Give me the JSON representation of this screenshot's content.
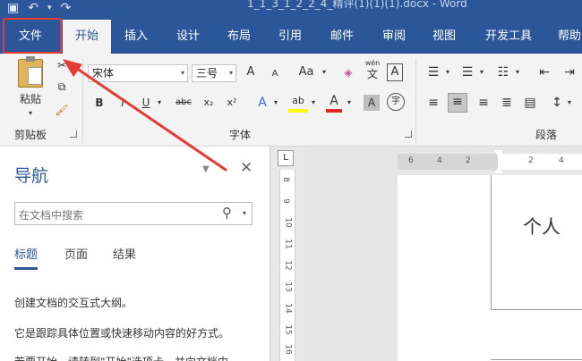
{
  "app": {
    "doc_title": "1_1_3_1_2_2_4_精评(1)(1)(1).docx  -  Word"
  },
  "quick_access": [
    {
      "icon": "save-icon",
      "glyph": "💾"
    },
    {
      "icon": "undo-icon",
      "glyph": "↶"
    },
    {
      "icon": "undo-dropdown-icon",
      "glyph": "▾"
    },
    {
      "icon": "redo-icon",
      "glyph": "↷"
    }
  ],
  "tabs": [
    {
      "label": "文件"
    },
    {
      "label": "开始"
    },
    {
      "label": "插入"
    },
    {
      "label": "设计"
    },
    {
      "label": "布局"
    },
    {
      "label": "引用"
    },
    {
      "label": "邮件"
    },
    {
      "label": "审阅"
    },
    {
      "label": "视图"
    },
    {
      "label": "开发工具"
    },
    {
      "label": "帮助"
    }
  ],
  "ribbon": {
    "clipboard": {
      "group_label": "剪贴板",
      "paste_label": "粘贴"
    },
    "font": {
      "group_label": "字体",
      "font_name": "宋体",
      "font_size": "三号",
      "grow_label": "A",
      "shrink_label": "A",
      "case_label": "Aa",
      "phonetic_label": "wén",
      "phonetic_char": "文",
      "border_char": "A",
      "bold": "B",
      "italic": "I",
      "underline": "U",
      "strike": "abc",
      "subscript": "x₂",
      "superscript": "x²",
      "effects": "A",
      "highlight": "ab",
      "font_color": "A",
      "shade": "A",
      "enclose": "字"
    },
    "paragraph": {
      "group_label": "段落"
    }
  },
  "nav": {
    "title": "导航",
    "close_glyph": "✕",
    "menu_glyph": "▼",
    "search_placeholder": "在文档中搜索",
    "tabs": [
      {
        "label": "标题"
      },
      {
        "label": "页面"
      },
      {
        "label": "结果"
      }
    ],
    "lines": [
      "创建文档的交互式大纲。",
      "它是跟踪具体位置或快速移动内容的好方式。",
      "若要开始，请转到\"开始\"选项卡，并向文档中"
    ]
  },
  "ruler": {
    "corner": "L",
    "vertical_numbers": [
      "8",
      "9",
      "10",
      "11",
      "12",
      "13",
      "14",
      "15",
      "16"
    ],
    "horizontal_numbers": [
      "6",
      "4",
      "2",
      "2",
      "4"
    ]
  },
  "document": {
    "visible_text": "个人"
  },
  "colors": {
    "accent": "#2b579a",
    "highlight_box": "#e63b34",
    "arrow": "#e63b34"
  }
}
